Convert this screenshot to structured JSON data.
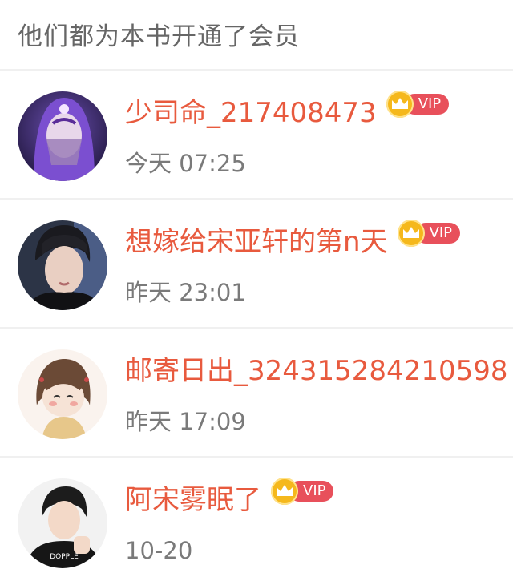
{
  "header": {
    "title": "他们都为本书开通了会员"
  },
  "vip_badge_label": "VIP",
  "colors": {
    "name": "#e85a3e",
    "vip_pill": "#e8505b",
    "crown": "#f5b81c",
    "time": "#7a7a7a",
    "header_text": "#666666"
  },
  "members": [
    {
      "name": "少司命_217408473",
      "time": "今天 07:25",
      "avatar": "purple-hair-character"
    },
    {
      "name": "想嫁给宋亚轩的第n天",
      "time": "昨天 23:01",
      "avatar": "young-man-photo"
    },
    {
      "name": "邮寄日出_324315284210598",
      "time": "昨天 17:09",
      "avatar": "cartoon-girl-drawing"
    },
    {
      "name": "阿宋雾眠了",
      "time": "10-20",
      "avatar": "young-man-thumbs-up"
    }
  ]
}
